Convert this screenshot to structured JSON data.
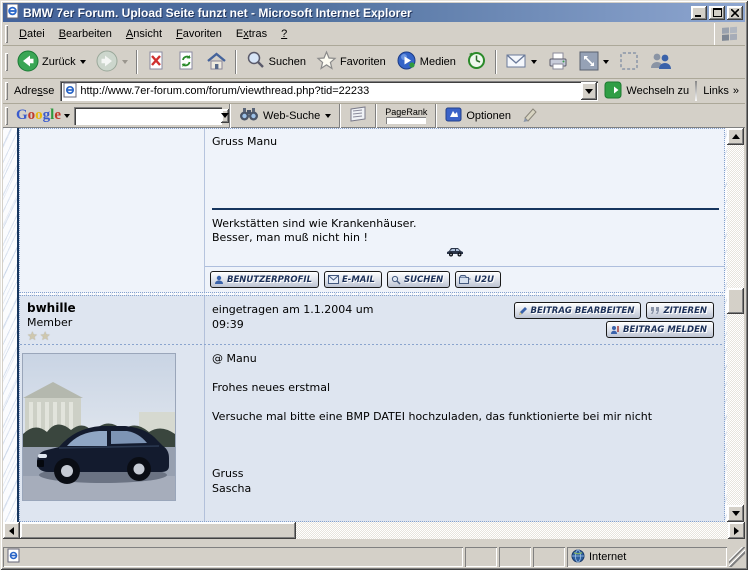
{
  "window": {
    "title": "BMW 7er Forum. Upload Seite funzt net - Microsoft Internet Explorer"
  },
  "menu": {
    "items": [
      {
        "pre": "",
        "key": "D",
        "post": "atei"
      },
      {
        "pre": "",
        "key": "B",
        "post": "earbeiten"
      },
      {
        "pre": "",
        "key": "A",
        "post": "nsicht"
      },
      {
        "pre": "",
        "key": "F",
        "post": "avoriten"
      },
      {
        "pre": "E",
        "key": "x",
        "post": "tras"
      },
      {
        "pre": "",
        "key": "?",
        "post": ""
      }
    ]
  },
  "toolbar": {
    "back_label": "Zurück",
    "search_label": "Suchen",
    "favorites_label": "Favoriten",
    "media_label": "Medien"
  },
  "address": {
    "label": {
      "pre": "Adre",
      "key": "s",
      "post": "se"
    },
    "url": "http://www.7er-forum.com/forum/viewthread.php?tid=22233",
    "go_label": "Wechseln zu",
    "links_label": "Links",
    "links_chevron": "»"
  },
  "google": {
    "logo_letters": [
      "G",
      "o",
      "o",
      "g",
      "l",
      "e"
    ],
    "dropdown_glyph": "▾",
    "search_value": "",
    "web_search_label": "Web-Suche",
    "pagerank_label": "PageRank",
    "options_label": "Optionen"
  },
  "post1": {
    "message_tail": "Gruss Manu",
    "signature_line1": "Werkstätten sind wie Krankenhäuser.",
    "signature_line2": "Besser, man muß nicht hin !",
    "buttons": [
      "BENUTZERPROFIL",
      "E-MAIL",
      "SUCHEN",
      "U2U"
    ]
  },
  "post2": {
    "author": "bwhille",
    "rank": "Member",
    "stars": "★★",
    "posted_line1": "eingetragen am 1.1.2004 um",
    "posted_line2": "09:39",
    "buttons_row1": [
      "BEITRAG BEARBEITEN",
      "ZITIEREN"
    ],
    "buttons_row2": [
      "BEITRAG MELDEN"
    ],
    "message_lines": [
      "@ Manu",
      "Frohes neues erstmal",
      "Versuche mal bitte eine BMP DATEI hochzuladen, das funktionierte bei mir nicht",
      "Gruss",
      "Sascha"
    ]
  },
  "statusbar": {
    "zone_label": "Internet"
  },
  "colors": {
    "titlebar_left": "#44639b",
    "titlebar_right": "#8ea6d0",
    "chrome": "#d4d0c8",
    "post1_bg": "#eff3fa",
    "post2_bg": "#dee5f0",
    "table_line": "#16355e",
    "post_border": "#84a0cc"
  }
}
